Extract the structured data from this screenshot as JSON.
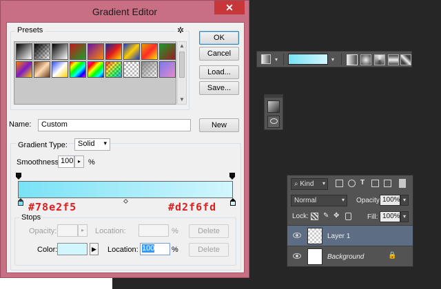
{
  "window": {
    "title": "Gradient Editor",
    "close": "✕"
  },
  "presets": {
    "label": "Presets",
    "gear": "✲",
    "scroll_up": "▲",
    "scroll_down": "▼",
    "swatches": [
      {
        "kind": "linear",
        "colors": [
          "#000000",
          "#ffffff"
        ]
      },
      {
        "kind": "checker-fade",
        "colors": [
          "#000000",
          "#ffffff"
        ]
      },
      {
        "kind": "linear",
        "colors": [
          "#000000",
          "#ffffff"
        ]
      },
      {
        "kind": "linear",
        "colors": [
          "#c6181d",
          "#17a027"
        ]
      },
      {
        "kind": "linear",
        "colors": [
          "#6b12a6",
          "#ff8a00"
        ]
      },
      {
        "kind": "linear",
        "colors": [
          "#1b2a9c",
          "#e31b1b",
          "#ffdd00"
        ]
      },
      {
        "kind": "linear",
        "colors": [
          "#1a3ac8",
          "#ffcc00",
          "#1a3ac8"
        ]
      },
      {
        "kind": "linear",
        "colors": [
          "#e6a100",
          "#ff2a2a",
          "#ffe800"
        ]
      },
      {
        "kind": "linear",
        "colors": [
          "#1c9a2b",
          "#9b1c1c"
        ]
      },
      {
        "kind": "linear",
        "colors": [
          "#ff7a00",
          "#7a1ac8",
          "#ffcc00"
        ]
      },
      {
        "kind": "linear",
        "colors": [
          "#6a3a1a",
          "#ffd9b0",
          "#6a3a1a"
        ]
      },
      {
        "kind": "linear",
        "colors": [
          "#3050ff",
          "#ffffff",
          "#ffd000"
        ]
      },
      {
        "kind": "rainbow",
        "colors": [
          "#ff0000",
          "#ffff00",
          "#00ff00",
          "#00ffff",
          "#0000ff",
          "#ff00ff"
        ]
      },
      {
        "kind": "rainbow",
        "colors": [
          "#ff00ff",
          "#ff0000",
          "#ffff00",
          "#00ff00",
          "#00ffff",
          "#0000ff"
        ]
      },
      {
        "kind": "checker-rainbow",
        "colors": [
          "#ff3b3b",
          "#ffe13b",
          "#3bff6b",
          "#3bb5ff"
        ]
      },
      {
        "kind": "checker",
        "colors": [
          "#ffffff",
          "#cccccc"
        ]
      },
      {
        "kind": "checker-fade",
        "colors": [
          "#8a8a8a",
          "#ffffff"
        ]
      },
      {
        "kind": "linear",
        "colors": [
          "#7a7af0",
          "#e58ac8"
        ]
      }
    ]
  },
  "buttons": {
    "ok": "OK",
    "cancel": "Cancel",
    "load": "Load...",
    "save": "Save...",
    "new": "New",
    "delete": "Delete"
  },
  "name": {
    "label": "Name:",
    "value": "Custom"
  },
  "gradient": {
    "type_label": "Gradient Type:",
    "type_value": "Solid",
    "smoothness_label": "Smoothness:",
    "smoothness_value": "100",
    "percent": "%",
    "start_color": "#78e2f5",
    "end_color": "#d2f6fd",
    "annot_left": "#78e2f5",
    "annot_right": "#d2f6fd"
  },
  "stops": {
    "label": "Stops",
    "opacity_label": "Opacity:",
    "location_label": "Location:",
    "color_label": "Color:",
    "color_value": "#d2f6fd",
    "location_value": "100",
    "arrow": "▶",
    "spin": "▸"
  },
  "optbar": {
    "gradient_preview": [
      "#78e2f5",
      "#d2f6fd"
    ],
    "caret": "▾"
  },
  "layers": {
    "kind_label": "Kind",
    "mode": "Normal",
    "opacity_label": "Opacity:",
    "opacity_value": "100%",
    "lock_label": "Lock:",
    "fill_label": "Fill:",
    "fill_value": "100%",
    "caret": "▾",
    "items": [
      {
        "name": "Layer 1",
        "selected": true,
        "thumb": "checker"
      },
      {
        "name": "Background",
        "selected": false,
        "thumb": "white",
        "locked": true
      }
    ],
    "lock_glyph": "🔒"
  }
}
